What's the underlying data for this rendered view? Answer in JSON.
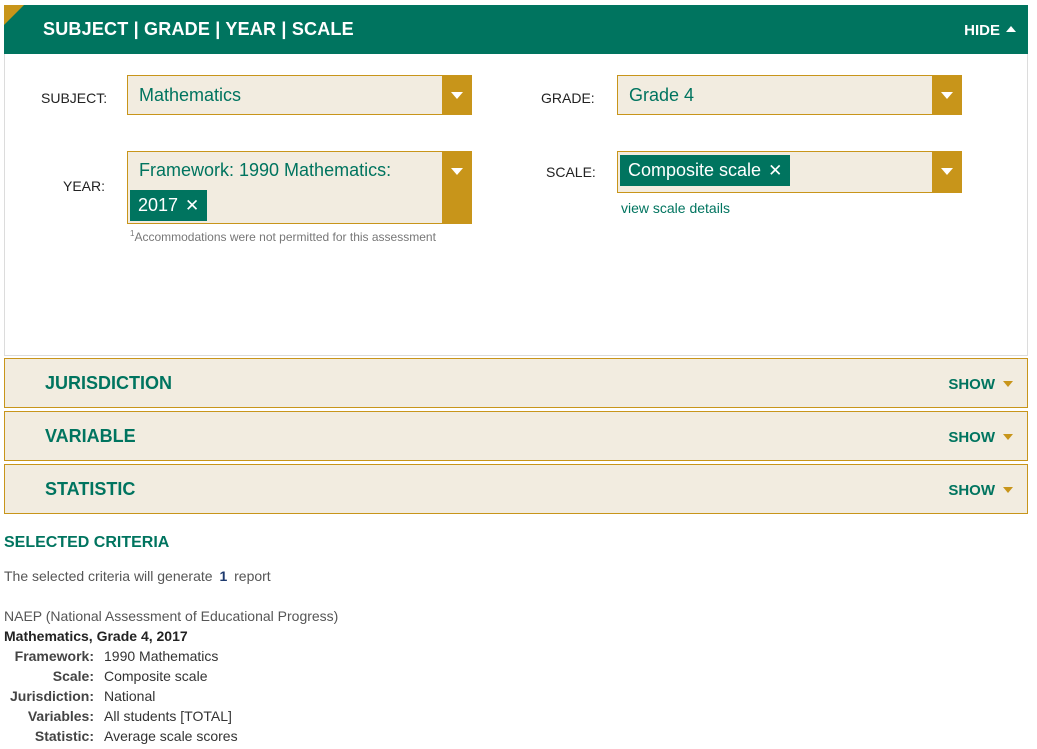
{
  "header": {
    "title": "SUBJECT | GRADE | YEAR | SCALE",
    "toggle_label": "HIDE"
  },
  "subject": {
    "label": "SUBJECT:",
    "value": "Mathematics"
  },
  "grade": {
    "label": "GRADE:",
    "value": "Grade 4"
  },
  "year": {
    "label": "YEAR:",
    "placeholder_text": "Framework: 1990 Mathematics:",
    "chip": "2017",
    "footnote_mark": "1",
    "footnote": "Accommodations were not permitted for this assessment"
  },
  "scale": {
    "label": "SCALE:",
    "chip": "Composite scale",
    "link": "view scale details"
  },
  "accordions": [
    {
      "title": "JURISDICTION",
      "toggle": "SHOW"
    },
    {
      "title": "VARIABLE",
      "toggle": "SHOW"
    },
    {
      "title": "STATISTIC",
      "toggle": "SHOW"
    }
  ],
  "criteria": {
    "title": "SELECTED CRITERIA",
    "generate_prefix": "The selected criteria will generate",
    "report_count": "1",
    "generate_suffix": "report",
    "source": "NAEP (National Assessment of Educational Progress)",
    "heading": "Mathematics, Grade 4, 2017",
    "rows": [
      {
        "key": "Framework:",
        "value": "1990 Mathematics"
      },
      {
        "key": "Scale:",
        "value": "Composite scale"
      },
      {
        "key": "Jurisdiction:",
        "value": "National"
      },
      {
        "key": "Variables:",
        "value": "All students [TOTAL]"
      },
      {
        "key": "Statistic:",
        "value": "Average scale scores"
      }
    ]
  },
  "colors": {
    "brand_green": "#00745f",
    "accent_gold": "#c8951a",
    "panel_beige": "#f2ece0"
  },
  "icons": {
    "chip_remove": "close-icon",
    "dropdown": "chevron-down-icon",
    "collapse": "caret-up-icon",
    "expand": "caret-down-icon"
  }
}
